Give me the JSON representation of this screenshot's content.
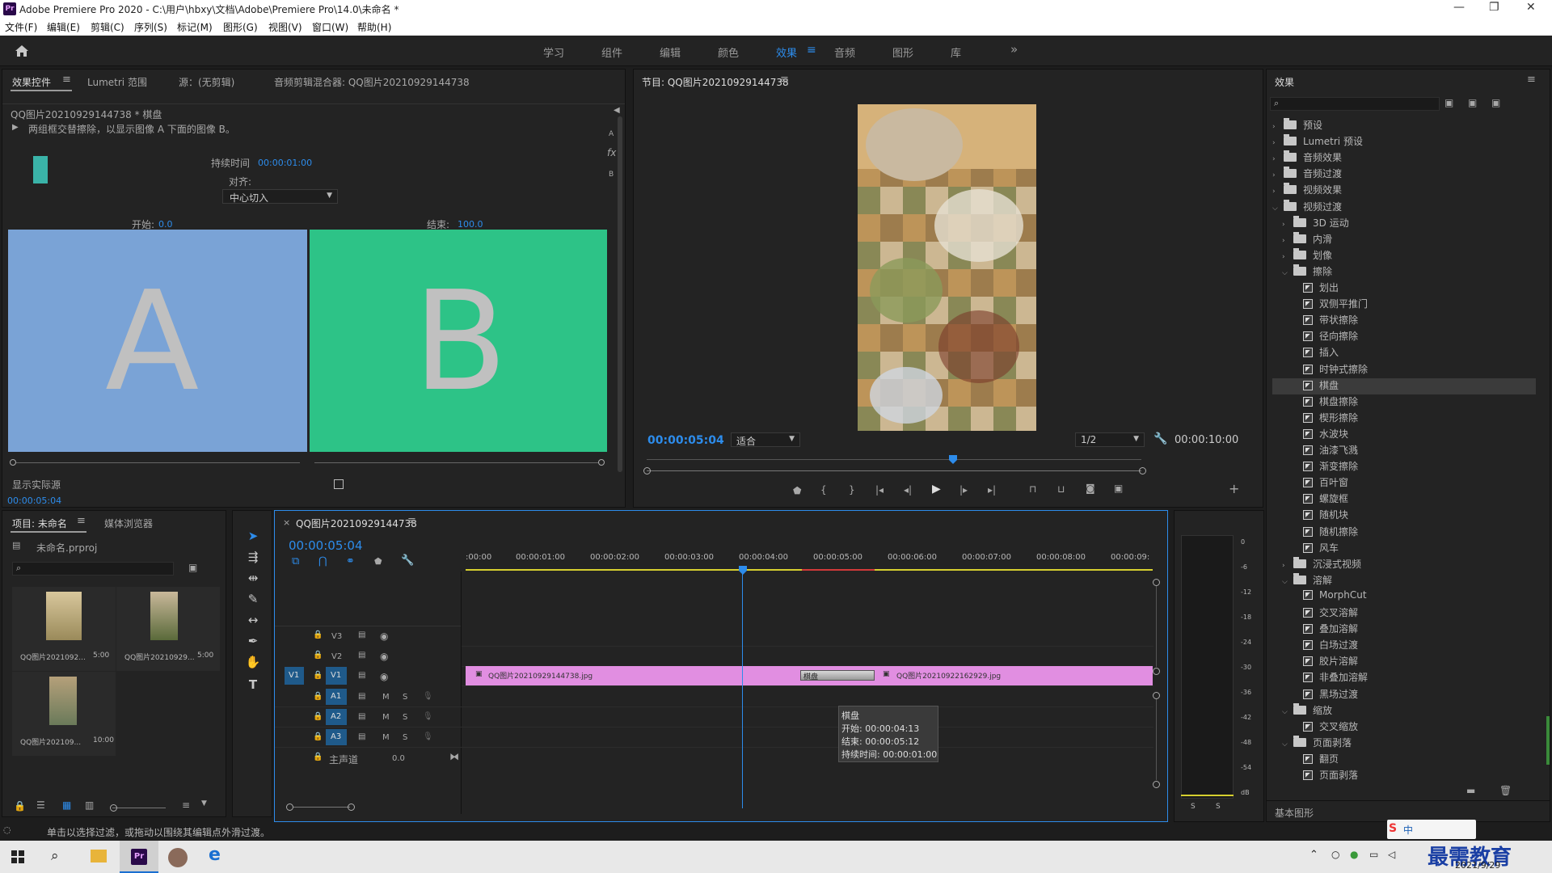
{
  "window": {
    "title": "Adobe Premiere Pro 2020 - C:\\用户\\hbxy\\文档\\Adobe\\Premiere Pro\\14.0\\未命名 *",
    "min": "—",
    "max": "❐",
    "close": "✕"
  },
  "menu": [
    "文件(F)",
    "编辑(E)",
    "剪辑(C)",
    "序列(S)",
    "标记(M)",
    "图形(G)",
    "视图(V)",
    "窗口(W)",
    "帮助(H)"
  ],
  "workspaces": [
    "学习",
    "组件",
    "编辑",
    "颜色",
    "效果",
    "音频",
    "图形",
    "库"
  ],
  "workspace_more": "»",
  "effect_controls": {
    "tabs": [
      "效果控件",
      "Lumetri 范围",
      "源：(无剪辑)",
      "音频剪辑混合器: QQ图片20210929144738"
    ],
    "clip_title": "QQ图片20210929144738 * 棋盘",
    "description": "两组框交替擦除，以显示图像 A 下面的图像 B。",
    "duration_label": "持续时间",
    "duration_value": "00:00:01:00",
    "align_label": "对齐:",
    "align_value": "中心切入",
    "start_label": "开始:",
    "start_value": "0.0",
    "end_label": "结束:",
    "end_value": "100.0",
    "preview_a": "A",
    "preview_b": "B",
    "show_source": "显示实际源",
    "time": "00:00:05:04",
    "side_a": "A",
    "side_b": "B",
    "fx": "fx"
  },
  "program": {
    "title": "节目: QQ图片20210929144738",
    "timecode": "00:00:05:04",
    "fit": "适合",
    "quality": "1/2",
    "duration": "00:00:10:00"
  },
  "project": {
    "tabs": [
      "项目: 未命名",
      "媒体浏览器"
    ],
    "file": "未命名.prproj",
    "items": [
      {
        "name": "QQ图片2021092...",
        "dur": "5:00"
      },
      {
        "name": "QQ图片20210929...",
        "dur": "5:00"
      },
      {
        "name": "QQ图片202109...",
        "dur": "10:00"
      }
    ]
  },
  "timeline": {
    "tab": "QQ图片20210929144738",
    "timecode": "00:00:05:04",
    "ruler": [
      ":00:00",
      "00:00:01:00",
      "00:00:02:00",
      "00:00:03:00",
      "00:00:04:00",
      "00:00:05:00",
      "00:00:06:00",
      "00:00:07:00",
      "00:00:08:00",
      "00:00:09:"
    ],
    "tracks": [
      "V3",
      "V2",
      "V1",
      "A1",
      "A2",
      "A3"
    ],
    "src_v1": "V1",
    "master": "主声道",
    "master_val": "0.0",
    "clip1": "QQ图片20210929144738.jpg",
    "clip2": "QQ图片20210922162929.jpg",
    "transition": "棋盘",
    "tooltip": {
      "name": "棋盘",
      "start": "开始: 00:00:04:13",
      "end": "结束: 00:00:05:12",
      "dur": "持续时间: 00:00:01:00"
    },
    "m": "M",
    "s": "S"
  },
  "meter": {
    "scale": [
      "0",
      "-6",
      "-12",
      "-18",
      "-24",
      "-30",
      "-36",
      "-42",
      "-48",
      "-54",
      "dB"
    ],
    "s": "S"
  },
  "effects": {
    "title": "效果",
    "tree": [
      {
        "label": "预设",
        "type": "folder",
        "level": 0,
        "open": false
      },
      {
        "label": "Lumetri 预设",
        "type": "folder",
        "level": 0,
        "open": false
      },
      {
        "label": "音频效果",
        "type": "folder",
        "level": 0,
        "open": false
      },
      {
        "label": "音频过渡",
        "type": "folder",
        "level": 0,
        "open": false
      },
      {
        "label": "视频效果",
        "type": "folder",
        "level": 0,
        "open": false
      },
      {
        "label": "视频过渡",
        "type": "folder",
        "level": 0,
        "open": true
      },
      {
        "label": "3D 运动",
        "type": "folder",
        "level": 1,
        "open": false
      },
      {
        "label": "内滑",
        "type": "folder",
        "level": 1,
        "open": false
      },
      {
        "label": "划像",
        "type": "folder",
        "level": 1,
        "open": false
      },
      {
        "label": "擦除",
        "type": "folder",
        "level": 1,
        "open": true
      },
      {
        "label": "划出",
        "type": "fx",
        "level": 2
      },
      {
        "label": "双侧平推门",
        "type": "fx",
        "level": 2
      },
      {
        "label": "带状擦除",
        "type": "fx",
        "level": 2
      },
      {
        "label": "径向擦除",
        "type": "fx",
        "level": 2
      },
      {
        "label": "插入",
        "type": "fx",
        "level": 2
      },
      {
        "label": "时钟式擦除",
        "type": "fx",
        "level": 2
      },
      {
        "label": "棋盘",
        "type": "fx",
        "level": 2,
        "selected": true
      },
      {
        "label": "棋盘擦除",
        "type": "fx",
        "level": 2
      },
      {
        "label": "楔形擦除",
        "type": "fx",
        "level": 2
      },
      {
        "label": "水波块",
        "type": "fx",
        "level": 2
      },
      {
        "label": "油漆飞溅",
        "type": "fx",
        "level": 2
      },
      {
        "label": "渐变擦除",
        "type": "fx",
        "level": 2
      },
      {
        "label": "百叶窗",
        "type": "fx",
        "level": 2
      },
      {
        "label": "螺旋框",
        "type": "fx",
        "level": 2
      },
      {
        "label": "随机块",
        "type": "fx",
        "level": 2
      },
      {
        "label": "随机擦除",
        "type": "fx",
        "level": 2
      },
      {
        "label": "风车",
        "type": "fx",
        "level": 2
      },
      {
        "label": "沉浸式视频",
        "type": "folder",
        "level": 1,
        "open": false
      },
      {
        "label": "溶解",
        "type": "folder",
        "level": 1,
        "open": true
      },
      {
        "label": "MorphCut",
        "type": "fx",
        "level": 2
      },
      {
        "label": "交叉溶解",
        "type": "fx",
        "level": 2
      },
      {
        "label": "叠加溶解",
        "type": "fx",
        "level": 2
      },
      {
        "label": "白场过渡",
        "type": "fx",
        "level": 2
      },
      {
        "label": "胶片溶解",
        "type": "fx",
        "level": 2
      },
      {
        "label": "非叠加溶解",
        "type": "fx",
        "level": 2
      },
      {
        "label": "黑场过渡",
        "type": "fx",
        "level": 2
      },
      {
        "label": "缩放",
        "type": "folder",
        "level": 1,
        "open": true
      },
      {
        "label": "交叉缩放",
        "type": "fx",
        "level": 2
      },
      {
        "label": "页面剥落",
        "type": "folder",
        "level": 1,
        "open": true
      },
      {
        "label": "翻页",
        "type": "fx",
        "level": 2
      },
      {
        "label": "页面剥落",
        "type": "fx",
        "level": 2
      }
    ],
    "footer": "基本图形"
  },
  "status": "单击以选择过滤，或拖动以围绕其编辑点外滑过渡。",
  "taskbar": {
    "date": "2021/9/29",
    "brand": "最需教育",
    "ime": "中"
  }
}
